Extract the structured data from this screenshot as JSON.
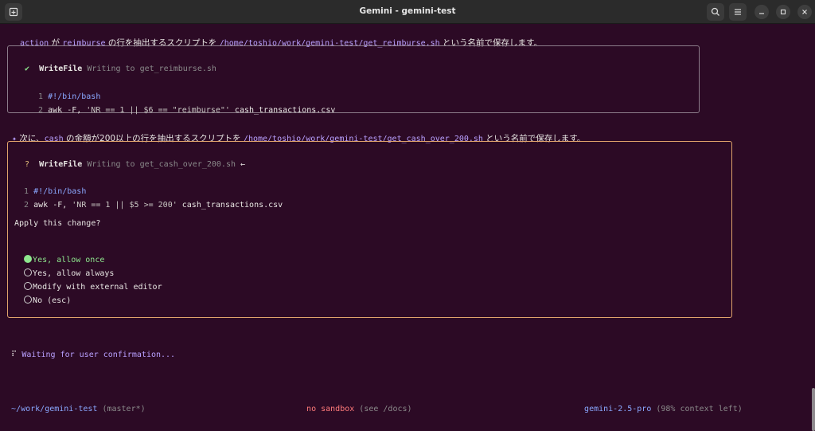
{
  "window": {
    "title": "Gemini - gemini-test"
  },
  "line1": {
    "w1": "action",
    "t1": " が ",
    "w2": "reimburse",
    "t2": " の行を抽出するスクリプトを ",
    "path": "/home/toshio/work/gemini-test/get_reimburse.sh",
    "t3": " という名前で保存します。"
  },
  "box1": {
    "check": "✔",
    "tool": "WriteFile",
    "desc": "Writing to get_reimburse.sh",
    "lines": [
      {
        "num": "1",
        "code": "#!/bin/bash"
      },
      {
        "num": "2",
        "code_a": "awk -F, ",
        "code_b": "'NR == 1 || $6 == \"reimburse\"'",
        "code_c": " cash_transactions.csv"
      }
    ]
  },
  "line2": {
    "bullet": "✦",
    "t1": " 次に、",
    "w1": "cash",
    "t2": " の金額が200以上の行を抽出するスクリプトを ",
    "path": "/home/toshio/work/gemini-test/get_cash_over_200.sh",
    "t3": " という名前で保存します。"
  },
  "box2": {
    "question": "?",
    "tool": "WriteFile",
    "desc": "Writing to get_cash_over_200.sh",
    "arrow": "←",
    "lines": [
      {
        "num": "1",
        "code": "#!/bin/bash"
      },
      {
        "num": "2",
        "code_a": "awk -F, ",
        "code_b": "'NR == 1 || $5 >= 200'",
        "code_c": " cash_transactions.csv"
      }
    ],
    "prompt": "Apply this change?",
    "options": [
      {
        "label": "Yes, allow once",
        "selected": true
      },
      {
        "label": "Yes, allow always",
        "selected": false
      },
      {
        "label": "Modify with external editor",
        "selected": false
      },
      {
        "label": "No (esc)",
        "selected": false
      }
    ]
  },
  "status": {
    "spinner": "⠏",
    "text": "Waiting for user confirmation..."
  },
  "footer": {
    "cwd": "~/work/gemini-test",
    "branch": "(master*)",
    "sandbox": "no sandbox",
    "sandbox_hint": "(see /docs)",
    "model": "gemini-2.5-pro",
    "context": "(98% context left)"
  }
}
